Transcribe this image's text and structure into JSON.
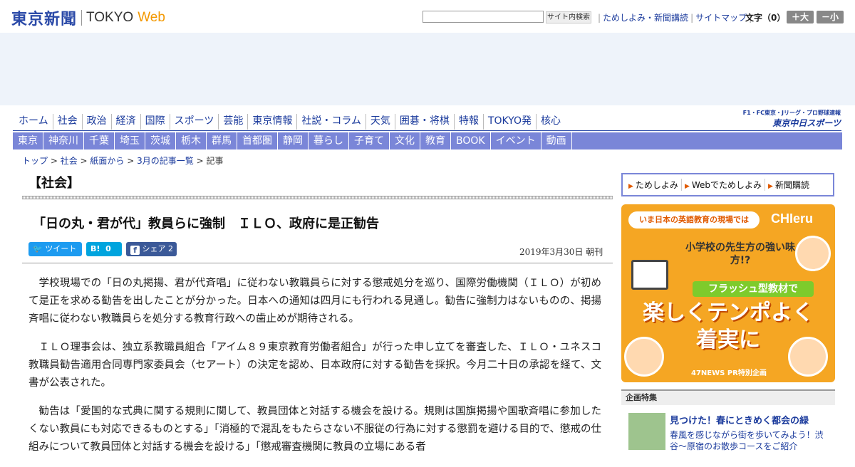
{
  "header": {
    "logo_jp": "東京新聞",
    "logo_en": "TOKYO",
    "logo_web": "Web",
    "search_placeholder": "",
    "search_button": "サイト内検索",
    "links": [
      "ためしよみ・新聞講読",
      "サイトマップ"
    ],
    "font_size_label": "文字（0）",
    "font_larger": "＋大",
    "font_smaller": "－小"
  },
  "nav_primary": [
    "ホーム",
    "社会",
    "政治",
    "経済",
    "国際",
    "スポーツ",
    "芸能",
    "東京情報",
    "社説・コラム",
    "天気",
    "囲碁・将棋",
    "特報",
    "TOKYO発",
    "核心"
  ],
  "chunichi": {
    "small": "F1・FC東京・Jリーグ・プロ野球速報",
    "big": "東京中日スポーツ"
  },
  "nav_secondary": [
    "東京",
    "神奈川",
    "千葉",
    "埼玉",
    "茨城",
    "栃木",
    "群馬",
    "首都圏",
    "静岡",
    "暮らし",
    "子育て",
    "文化",
    "教育",
    "BOOK",
    "イベント",
    "動画"
  ],
  "breadcrumb": {
    "items": [
      "トップ",
      "社会",
      "紙面から",
      "3月の記事一覧"
    ],
    "current": "記事",
    "sep": " > "
  },
  "article": {
    "section": "【社会】",
    "headline": "「日の丸・君が代」教員らに強制　ＩＬＯ、政府に是正勧告",
    "tweet_label": "ツイート",
    "hatena_label": "B!",
    "hatena_count": "0",
    "share_label": "シェア",
    "share_count": "2",
    "date": "2019年3月30日 朝刊",
    "paragraphs": [
      "学校現場での「日の丸掲揚、君が代斉唱」に従わない教職員らに対する懲戒処分を巡り、国際労働機関（ＩＬＯ）が初めて是正を求める勧告を出したことが分かった。日本への通知は四月にも行われる見通し。勧告に強制力はないものの、掲揚斉唱に従わない教職員らを処分する教育行政への歯止めが期待される。",
      "ＩＬＯ理事会は、独立系教職員組合「アイム８９東京教育労働者組合」が行った申し立てを審査した、ＩＬＯ・ユネスコ教職員勧告適用合同専門家委員会（セアート）の決定を認め、日本政府に対する勧告を採択。今月二十日の承認を経て、文書が公表された。",
      "勧告は「愛国的な式典に関する規則に関して、教員団体と対話する機会を設ける。規則は国旗掲揚や国歌斉唱に参加したくない教員にも対応できるものとする」「消極的で混乱をもたらさない不服従の行為に対する懲罰を避ける目的で、懲戒の仕組みについて教員団体と対話する機会を設ける」「懲戒審査機関に教員の立場にある者"
    ]
  },
  "sidebar": {
    "subscribe": [
      "ためしよみ",
      "Webでためしよみ",
      "新聞購読"
    ],
    "ad": {
      "top_text": "いま日本の英語教育の現場では",
      "brand": "CHIeru",
      "sub": "小学校の先生方の強い味方!?",
      "ribbon": "フラッシュ型教材で",
      "main_line1": "楽しくテンポよく",
      "main_line2": "着実に",
      "footer": "47NEWS PR特別企画"
    },
    "feature_head": "企画特集",
    "feature_title": "見つけた！春にときめく都会の緑",
    "feature_desc": "春風を感じながら街を歩いてみよう！渋谷～原宿のお散歩コースをご紹介"
  },
  "colors": {
    "brand_blue": "#2b4aa8",
    "nav_purple": "#7a86d8",
    "web_orange": "#f39800",
    "twitter": "#1d9bf0",
    "facebook": "#3b5998"
  }
}
